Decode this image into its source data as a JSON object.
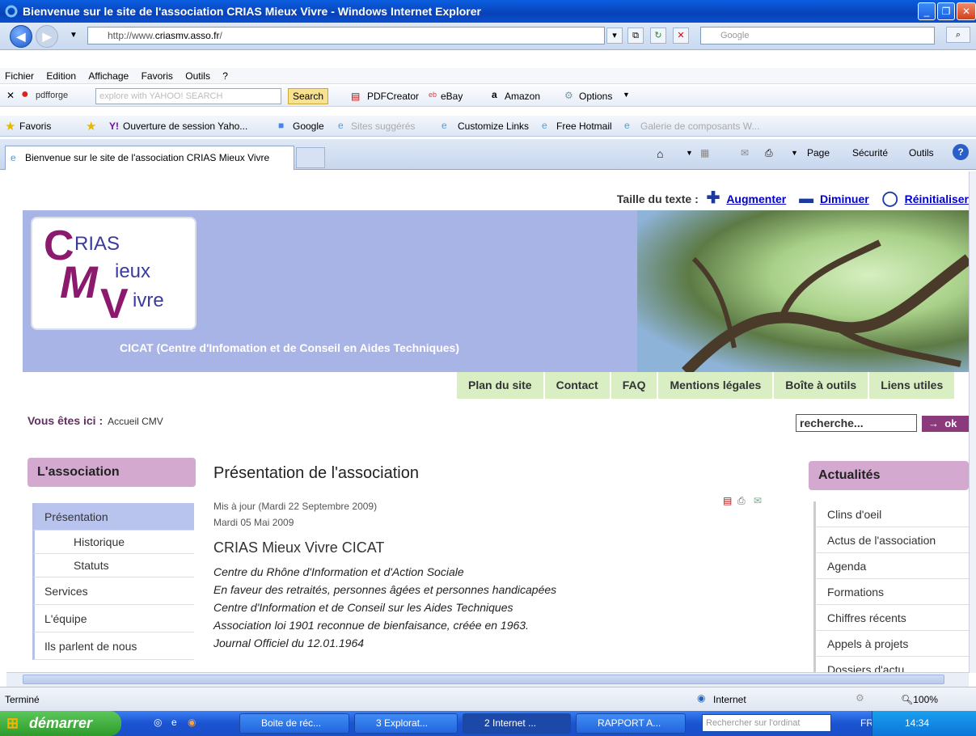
{
  "window": {
    "title": "Bienvenue sur le site de l'association CRIAS Mieux Vivre - Windows Internet Explorer"
  },
  "address": {
    "url_prefix": "http://www.",
    "url_domain": "criasmv.asso.fr",
    "url_suffix": "/",
    "search_placeholder": "Google"
  },
  "menu": [
    "Fichier",
    "Edition",
    "Affichage",
    "Favoris",
    "Outils",
    "?"
  ],
  "yahoo": {
    "brand": "pdfforge",
    "search_placeholder": "explore with YAHOO! SEARCH",
    "search_button": "Search",
    "items": [
      "PDFCreator",
      "eBay",
      "Amazon",
      "Options"
    ]
  },
  "favorites": {
    "label": "Favoris",
    "items": [
      "Ouverture de session Yaho...",
      "Google",
      "Sites suggérés",
      "Customize Links",
      "Free Hotmail",
      "Galerie de composants W..."
    ]
  },
  "tab": {
    "label": "Bienvenue sur le site de l'association CRIAS Mieux Vivre",
    "commands": [
      "Page",
      "Sécurité",
      "Outils"
    ]
  },
  "page": {
    "textsize": {
      "label": "Taille du texte :",
      "increase": "Augmenter",
      "decrease": "Diminuer",
      "reset": "Réinitialiser"
    },
    "logo": {
      "l1": "RIAS",
      "l2": "ieux",
      "l3": "ivre",
      "c1": "C",
      "c2": "M",
      "c3": "V"
    },
    "tagline": "CICAT (Centre d'Infomation et de Conseil en Aides Techniques)",
    "topnav": [
      "Plan du site",
      "Contact",
      "FAQ",
      "Mentions légales",
      "Boîte à outils",
      "Liens utiles"
    ],
    "breadcrumb": {
      "label": "Vous êtes ici :",
      "value": "Accueil CMV"
    },
    "search": {
      "placeholder": "recherche...",
      "button": "ok"
    },
    "leftmenu": {
      "title": "L'association",
      "items": [
        {
          "label": "Présentation"
        },
        {
          "label": "Historique"
        },
        {
          "label": "Statuts"
        },
        {
          "label": "Services"
        },
        {
          "label": "L'équipe"
        },
        {
          "label": "Ils parlent de nous"
        }
      ]
    },
    "article": {
      "title": "Présentation de l'association",
      "updated": "Mis à jour (Mardi 22 Septembre 2009)",
      "date": "Mardi 05 Mai 2009",
      "heading": "CRIAS Mieux Vivre CICAT",
      "lines": [
        "Centre du Rhône d'Information et d'Action Sociale",
        "En faveur des retraités, personnes âgées et personnes handicapées",
        "Centre d'Information et de Conseil sur les Aides Techniques",
        "Association loi 1901 reconnue de bienfaisance, créée en 1963.",
        "Journal Officiel du 12.01.1964"
      ]
    },
    "rightmenu": {
      "title": "Actualités",
      "items": [
        "Clins d'oeil",
        "Actus de l'association",
        "Agenda",
        "Formations",
        "Chiffres récents",
        "Appels à projets",
        "Dossiers d'actu"
      ]
    }
  },
  "status": {
    "text": "Terminé",
    "zone": "Internet",
    "zoom": "100%"
  },
  "taskbar": {
    "start": "démarrer",
    "tasks": [
      "Boite de réc...",
      "3 Explorat...",
      "2 Internet ...",
      "RAPPORT A..."
    ],
    "search_placeholder": "Rechercher sur l'ordinat",
    "lang": "FR",
    "time": "14:34"
  }
}
